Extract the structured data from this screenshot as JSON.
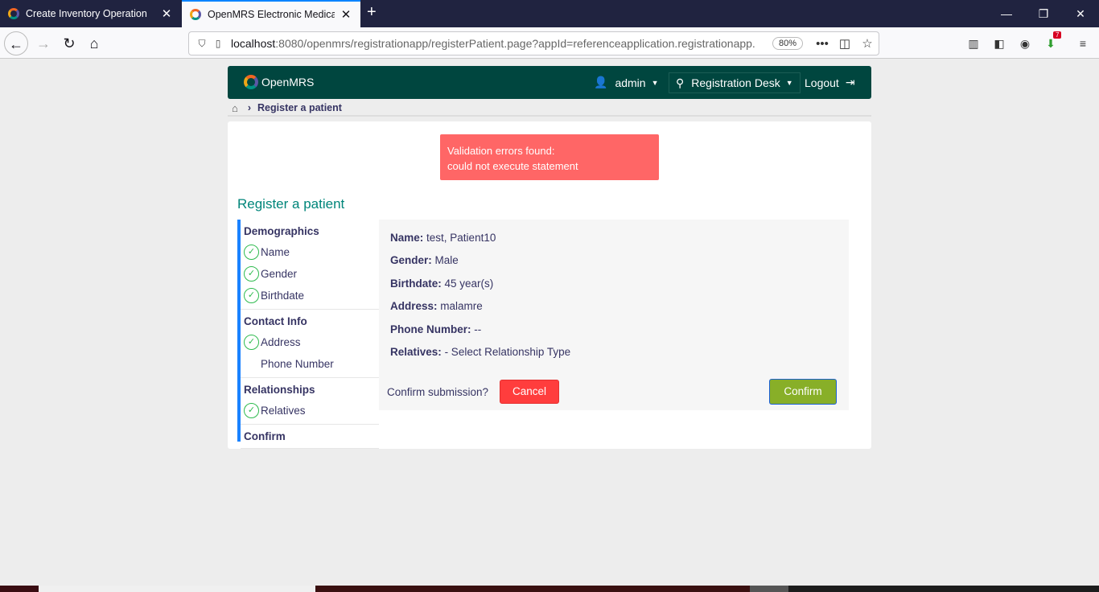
{
  "browser": {
    "tabs": [
      {
        "title": "Create Inventory Operation",
        "active": false
      },
      {
        "title": "OpenMRS Electronic Medical Re",
        "active": true
      }
    ],
    "url_host": "localhost",
    "url_rest": ":8080/openmrs/registrationapp/registerPatient.page?appId=referenceapplication.registrationapp.",
    "zoom": "80%",
    "downloads_badge": "7"
  },
  "header": {
    "logo_text": "OpenMRS",
    "user": "admin",
    "location": "Registration Desk",
    "logout": "Logout"
  },
  "breadcrumb": {
    "current": "Register a patient"
  },
  "alert": {
    "line1": "Validation errors found:",
    "line2": "could not execute statement"
  },
  "page_title": "Register a patient",
  "sections": [
    {
      "title": "Demographics",
      "steps": [
        "Name",
        "Gender",
        "Birthdate"
      ]
    },
    {
      "title": "Contact Info",
      "steps": [
        "Address",
        "Phone Number"
      ]
    },
    {
      "title": "Relationships",
      "steps": [
        "Relatives"
      ]
    },
    {
      "title": "Confirm",
      "steps": []
    }
  ],
  "summary": {
    "name_label": "Name:",
    "name_value": "test, Patient10",
    "gender_label": "Gender:",
    "gender_value": "Male",
    "birthdate_label": "Birthdate:",
    "birthdate_value": "45 year(s)",
    "address_label": "Address:",
    "address_value": "malamre",
    "phone_label": "Phone Number:",
    "phone_value": "--",
    "relatives_label": "Relatives:",
    "relatives_value": "- Select Relationship Type"
  },
  "confirm": {
    "question": "Confirm submission?",
    "cancel_label": "Cancel",
    "confirm_label": "Confirm"
  }
}
